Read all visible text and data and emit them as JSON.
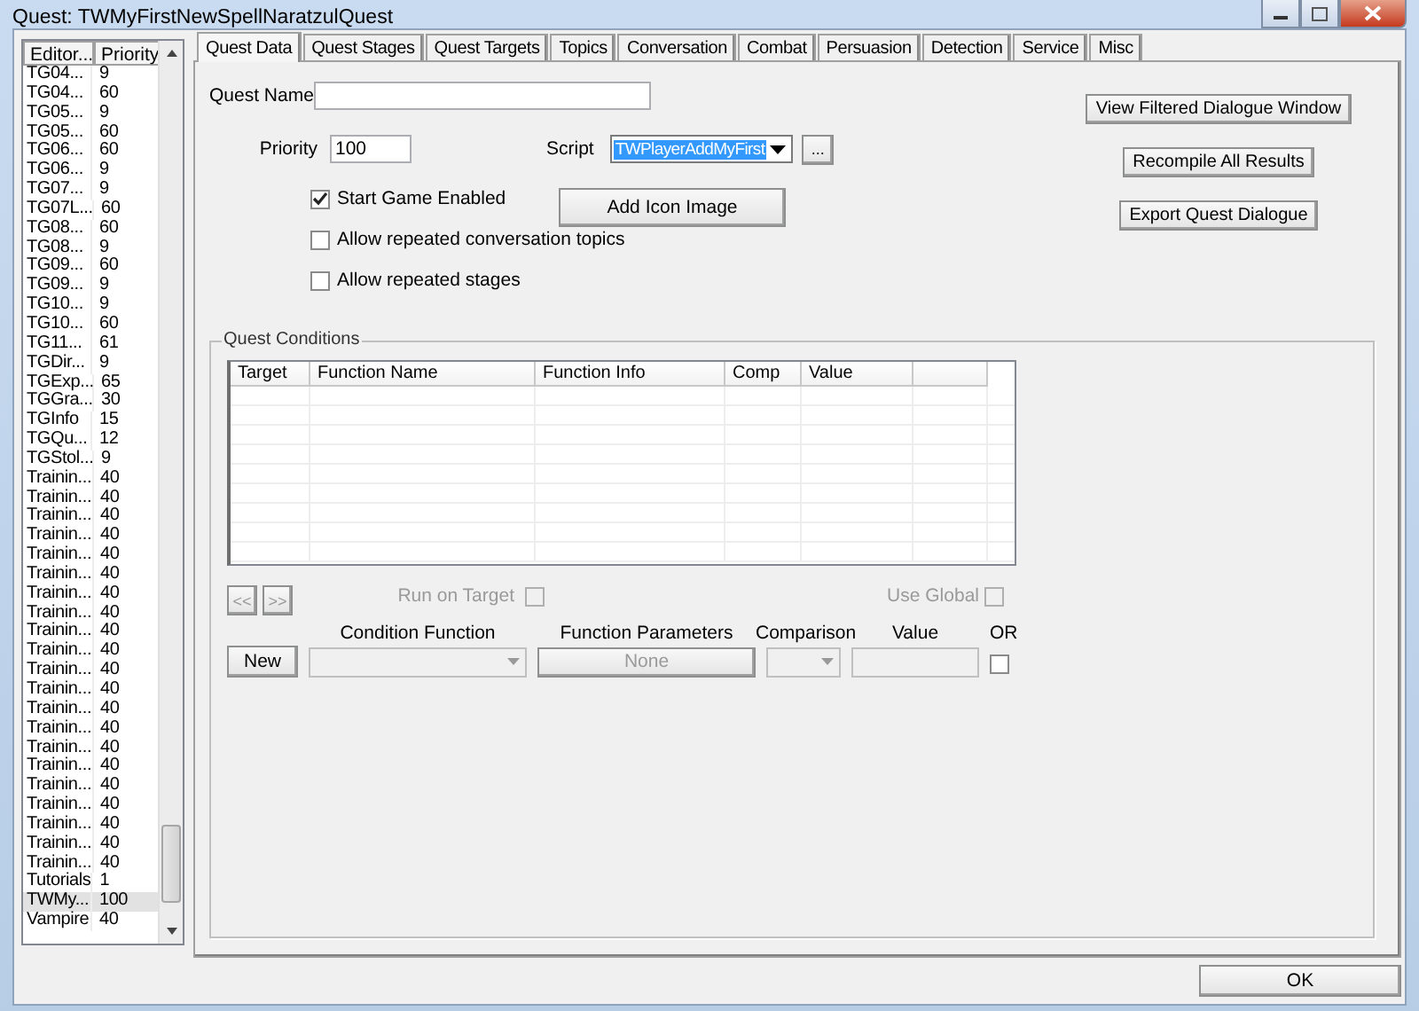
{
  "window": {
    "title": "Quest: TWMyFirstNewSpellNaratzulQuest"
  },
  "quest_list": {
    "columns": [
      "Editor...",
      "Priority"
    ],
    "rows": [
      {
        "editor_id": "TG04...",
        "priority": "9",
        "selected": false
      },
      {
        "editor_id": "TG04...",
        "priority": "60",
        "selected": false
      },
      {
        "editor_id": "TG05...",
        "priority": "9",
        "selected": false
      },
      {
        "editor_id": "TG05...",
        "priority": "60",
        "selected": false
      },
      {
        "editor_id": "TG06...",
        "priority": "60",
        "selected": false
      },
      {
        "editor_id": "TG06...",
        "priority": "9",
        "selected": false
      },
      {
        "editor_id": "TG07...",
        "priority": "9",
        "selected": false
      },
      {
        "editor_id": "TG07L...",
        "priority": "60",
        "selected": false
      },
      {
        "editor_id": "TG08...",
        "priority": "60",
        "selected": false
      },
      {
        "editor_id": "TG08...",
        "priority": "9",
        "selected": false
      },
      {
        "editor_id": "TG09...",
        "priority": "60",
        "selected": false
      },
      {
        "editor_id": "TG09...",
        "priority": "9",
        "selected": false
      },
      {
        "editor_id": "TG10...",
        "priority": "9",
        "selected": false
      },
      {
        "editor_id": "TG10...",
        "priority": "60",
        "selected": false
      },
      {
        "editor_id": "TG11...",
        "priority": "61",
        "selected": false
      },
      {
        "editor_id": "TGDir...",
        "priority": "9",
        "selected": false
      },
      {
        "editor_id": "TGExp...",
        "priority": "65",
        "selected": false
      },
      {
        "editor_id": "TGGra...",
        "priority": "30",
        "selected": false
      },
      {
        "editor_id": "TGInfo",
        "priority": "15",
        "selected": false
      },
      {
        "editor_id": "TGQu...",
        "priority": "12",
        "selected": false
      },
      {
        "editor_id": "TGStol...",
        "priority": "9",
        "selected": false
      },
      {
        "editor_id": "Trainin...",
        "priority": "40",
        "selected": false
      },
      {
        "editor_id": "Trainin...",
        "priority": "40",
        "selected": false
      },
      {
        "editor_id": "Trainin...",
        "priority": "40",
        "selected": false
      },
      {
        "editor_id": "Trainin...",
        "priority": "40",
        "selected": false
      },
      {
        "editor_id": "Trainin...",
        "priority": "40",
        "selected": false
      },
      {
        "editor_id": "Trainin...",
        "priority": "40",
        "selected": false
      },
      {
        "editor_id": "Trainin...",
        "priority": "40",
        "selected": false
      },
      {
        "editor_id": "Trainin...",
        "priority": "40",
        "selected": false
      },
      {
        "editor_id": "Trainin...",
        "priority": "40",
        "selected": false
      },
      {
        "editor_id": "Trainin...",
        "priority": "40",
        "selected": false
      },
      {
        "editor_id": "Trainin...",
        "priority": "40",
        "selected": false
      },
      {
        "editor_id": "Trainin...",
        "priority": "40",
        "selected": false
      },
      {
        "editor_id": "Trainin...",
        "priority": "40",
        "selected": false
      },
      {
        "editor_id": "Trainin...",
        "priority": "40",
        "selected": false
      },
      {
        "editor_id": "Trainin...",
        "priority": "40",
        "selected": false
      },
      {
        "editor_id": "Trainin...",
        "priority": "40",
        "selected": false
      },
      {
        "editor_id": "Trainin...",
        "priority": "40",
        "selected": false
      },
      {
        "editor_id": "Trainin...",
        "priority": "40",
        "selected": false
      },
      {
        "editor_id": "Trainin...",
        "priority": "40",
        "selected": false
      },
      {
        "editor_id": "Trainin...",
        "priority": "40",
        "selected": false
      },
      {
        "editor_id": "Trainin...",
        "priority": "40",
        "selected": false
      },
      {
        "editor_id": "Tutorials",
        "priority": "1",
        "selected": false
      },
      {
        "editor_id": "TWMy...",
        "priority": "100",
        "selected": true
      },
      {
        "editor_id": "Vampire",
        "priority": "40",
        "selected": false
      }
    ]
  },
  "tabs": [
    {
      "label": "Quest Data",
      "selected": true
    },
    {
      "label": "Quest Stages",
      "selected": false
    },
    {
      "label": "Quest Targets",
      "selected": false
    },
    {
      "label": "Topics",
      "selected": false
    },
    {
      "label": "Conversation",
      "selected": false
    },
    {
      "label": "Combat",
      "selected": false
    },
    {
      "label": "Persuasion",
      "selected": false
    },
    {
      "label": "Detection",
      "selected": false
    },
    {
      "label": "Service",
      "selected": false
    },
    {
      "label": "Misc",
      "selected": false
    }
  ],
  "quest_data": {
    "quest_name": {
      "label": "Quest Name"
    },
    "priority": {
      "label": "Priority",
      "value": "100"
    },
    "script": {
      "label": "Script",
      "value": "TWPlayerAddMyFirst",
      "browse_button": "..."
    },
    "add_icon_button": "Add Icon Image",
    "options": [
      {
        "label": "Start Game Enabled",
        "checked": true
      },
      {
        "label": "Allow repeated conversation topics",
        "checked": false
      },
      {
        "label": "Allow repeated stages",
        "checked": false
      }
    ],
    "actions": [
      "View Filtered Dialogue Window",
      "Recompile All Results",
      "Export Quest Dialogue"
    ],
    "conditions": {
      "title": "Quest Conditions",
      "columns": [
        "Target",
        "Function Name",
        "Function Info",
        "Comp",
        "Value"
      ],
      "prev_button": {
        "label": "<<",
        "disabled": true
      },
      "next_button": {
        "label": ">>",
        "disabled": true
      },
      "run_on_target": {
        "label": "Run on Target",
        "checked": false,
        "disabled": true
      },
      "use_global": {
        "label": "Use Global",
        "checked": false,
        "disabled": true
      },
      "new_button": "New",
      "condition_function": {
        "label": "Condition Function",
        "disabled": true
      },
      "function_parameters": {
        "label": "Function Parameters",
        "button": "None",
        "disabled": true
      },
      "comparison": {
        "label": "Comparison",
        "disabled": true
      },
      "value": {
        "label": "Value",
        "disabled": true
      },
      "or": {
        "label": "OR",
        "checked": false
      }
    }
  },
  "ok_button": "OK"
}
